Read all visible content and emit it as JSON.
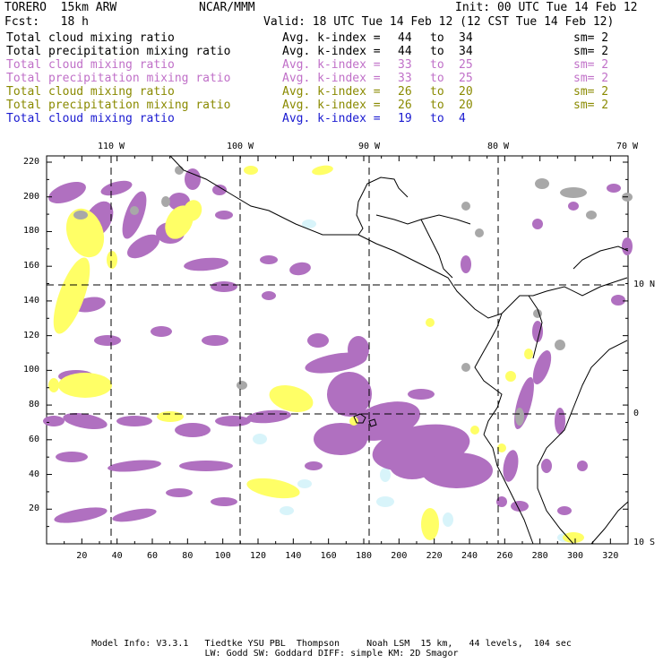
{
  "header": {
    "model": "TORERO  15km ARW",
    "org": "NCAR/MMM",
    "init": "Init: 00 UTC Tue 14 Feb 12",
    "fcst": "Fcst:   18 h",
    "valid": "Valid: 18 UTC Tue 14 Feb 12 (12 CST Tue 14 Feb 12)"
  },
  "legend": [
    {
      "field": "Total cloud mixing ratio",
      "avg": "Avg. k-index =",
      "v1": "44",
      "to": "to",
      "v2": "34",
      "sm": "sm= 2",
      "color": "#000000"
    },
    {
      "field": "Total precipitation mixing ratio",
      "avg": "Avg. k-index =",
      "v1": "44",
      "to": "to",
      "v2": "34",
      "sm": "sm= 2",
      "color": "#000000"
    },
    {
      "field": "Total cloud mixing ratio",
      "avg": "Avg. k-index =",
      "v1": "33",
      "to": "to",
      "v2": "25",
      "sm": "sm= 2",
      "color": "#c070c8"
    },
    {
      "field": "Total precipitation mixing ratio",
      "avg": "Avg. k-index =",
      "v1": "33",
      "to": "to",
      "v2": "25",
      "sm": "sm= 2",
      "color": "#c070c8"
    },
    {
      "field": "Total cloud mixing ratio",
      "avg": "Avg. k-index =",
      "v1": "26",
      "to": "to",
      "v2": "20",
      "sm": "sm= 2",
      "color": "#8a8a00"
    },
    {
      "field": "Total precipitation mixing ratio",
      "avg": "Avg. k-index =",
      "v1": "26",
      "to": "to",
      "v2": "20",
      "sm": "sm= 2",
      "color": "#8a8a00"
    },
    {
      "field": "Total cloud mixing ratio",
      "avg": "Avg. k-index =",
      "v1": "19",
      "to": "to",
      "v2": "4",
      "sm": "",
      "color": "#1a1ad0"
    }
  ],
  "axes": {
    "x_ticks": [
      "20",
      "40",
      "60",
      "80",
      "100",
      "120",
      "140",
      "160",
      "180",
      "200",
      "220",
      "240",
      "260",
      "280",
      "300",
      "320"
    ],
    "y_ticks": [
      "220",
      "200",
      "180",
      "160",
      "140",
      "120",
      "100",
      "80",
      "60",
      "40",
      "20"
    ],
    "lon_labels": [
      "110 W",
      "100 W",
      "90 W",
      "80 W",
      "70 W"
    ],
    "lat_labels": [
      "10 N",
      "0",
      "10 S"
    ]
  },
  "colors": {
    "magenta_fill": "#b070c0",
    "yellow_fill": "#ffff66",
    "gray_fill": "#a8a8a8",
    "light_blue_fill": "#d8f4fa",
    "coast": "#000000"
  },
  "footer": {
    "line1": "Model Info: V3.3.1   Tiedtke YSU PBL  Thompson     Noah LSM  15 km,   44 levels,  104 sec",
    "line2": "LW: Godd SW: Goddard DIFF: simple KM: 2D Smagor"
  }
}
